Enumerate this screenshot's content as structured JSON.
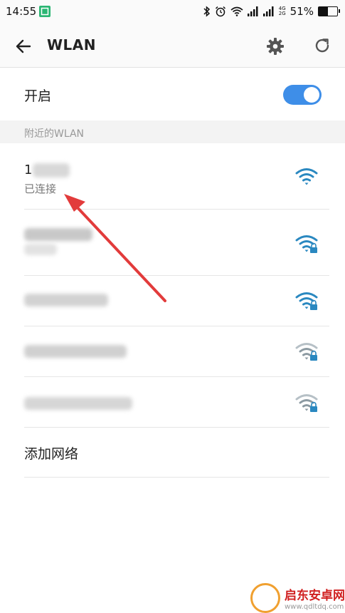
{
  "statusbar": {
    "time": "14:55",
    "network_top": "4G",
    "network_bottom": "2G",
    "battery": "51%",
    "battery_level": 0.51
  },
  "appbar": {
    "title": "WLAN"
  },
  "toggle": {
    "label": "开启",
    "on": true
  },
  "section": {
    "title": "附近的WLAN"
  },
  "networks": [
    {
      "ssid_visible": "1",
      "status": "已连接",
      "secured": false,
      "strength": "full",
      "active": true
    },
    {
      "ssid_visible": "",
      "secured": true,
      "strength": "full",
      "active": false
    },
    {
      "ssid_visible": "",
      "secured": true,
      "strength": "full",
      "active": false
    },
    {
      "ssid_visible": "",
      "secured": true,
      "strength": "medium",
      "active": false
    },
    {
      "ssid_visible": "",
      "secured": true,
      "strength": "medium",
      "active": false
    }
  ],
  "add_network": {
    "label": "添加网络"
  },
  "watermark": {
    "title": "启东安卓网",
    "url": "www.qdltdq.com"
  },
  "colors": {
    "accent": "#3e8ee8",
    "wifi_active": "#2a88c0",
    "wifi_inactive": "#8c9aa2",
    "annotation_arrow": "#e23b3b"
  }
}
